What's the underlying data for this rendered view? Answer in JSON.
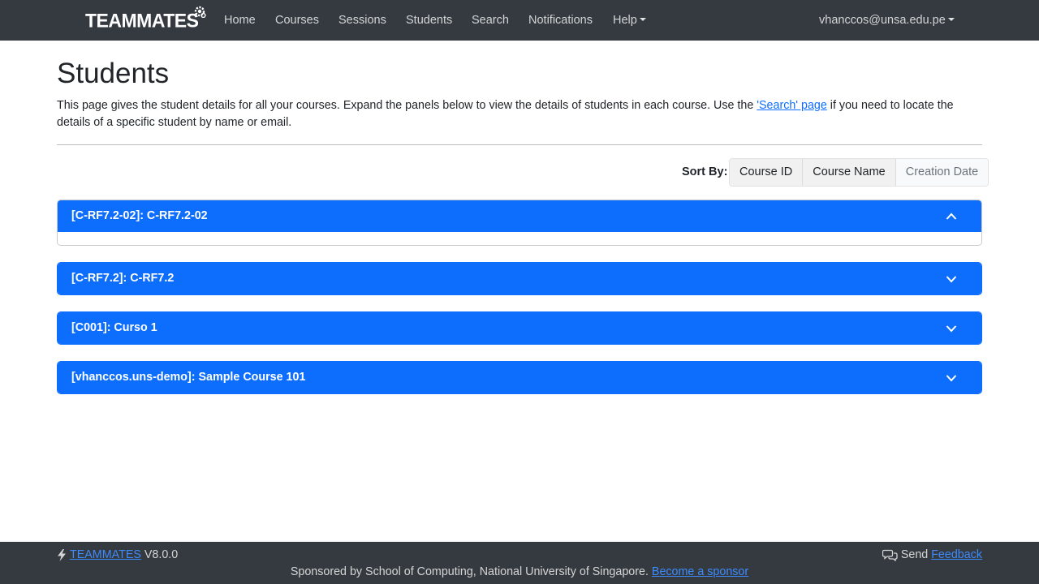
{
  "navbar": {
    "brand": "TEAMMATES",
    "items": [
      {
        "label": "Home"
      },
      {
        "label": "Courses"
      },
      {
        "label": "Sessions"
      },
      {
        "label": "Students"
      },
      {
        "label": "Search"
      },
      {
        "label": "Notifications"
      },
      {
        "label": "Help"
      }
    ],
    "user": "vhanccos@unsa.edu.pe"
  },
  "page": {
    "title": "Students",
    "intro_before": "This page gives the student details for all your courses. Expand the panels below to view the details of students in each course. Use the ",
    "intro_link": "'Search' page",
    "intro_after": " if you need to locate the details of a specific student by name or email."
  },
  "sort": {
    "label": "Sort By:",
    "options": [
      {
        "label": "Course ID"
      },
      {
        "label": "Course Name"
      },
      {
        "label": "Creation Date"
      }
    ]
  },
  "courses": [
    {
      "title": "[C-RF7.2-02]: C-RF7.2-02",
      "expanded": true
    },
    {
      "title": "[C-RF7.2]: C-RF7.2",
      "expanded": false
    },
    {
      "title": "[C001]: Curso 1",
      "expanded": false
    },
    {
      "title": "[vhanccos.uns-demo]: Sample Course 101",
      "expanded": false
    }
  ],
  "footer": {
    "brand_link": "TEAMMATES",
    "version": "V8.0.0",
    "send": "Send",
    "feedback_link": "Feedback",
    "sponsor_text": "Sponsored by School of Computing, National University of Singapore.",
    "sponsor_link": "Become a sponsor"
  },
  "colors": {
    "navbar": "#343a40",
    "primary": "#0d6efd",
    "footer": "#343a40"
  }
}
